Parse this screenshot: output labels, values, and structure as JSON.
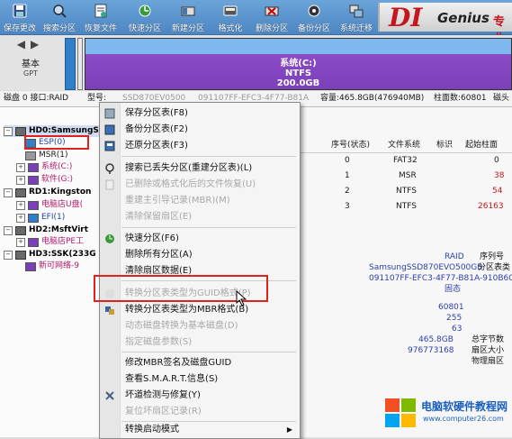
{
  "toolbar": {
    "buttons": [
      {
        "label": "保存更改",
        "icon": "save-icon"
      },
      {
        "label": "搜索分区",
        "icon": "search-partition-icon"
      },
      {
        "label": "恢复文件",
        "icon": "recover-file-icon"
      },
      {
        "label": "快速分区",
        "icon": "quick-partition-icon"
      },
      {
        "label": "新建分区",
        "icon": "new-partition-icon"
      },
      {
        "label": "格式化",
        "icon": "format-icon"
      },
      {
        "label": "删除分区",
        "icon": "delete-partition-icon"
      },
      {
        "label": "备份分区",
        "icon": "backup-partition-icon"
      },
      {
        "label": "系统迁移",
        "icon": "system-migrate-icon"
      }
    ],
    "logo": {
      "d": "DI",
      "genius": "Genius",
      "tail": "专业"
    }
  },
  "diskbar": {
    "nav_label": "基本",
    "nav_sub": "GPT",
    "partition_name": "系统(C:)",
    "partition_fs": "NTFS",
    "partition_size": "200.0GB"
  },
  "infoline": {
    "disk": "磁盘 0 接口:RAID",
    "model": "型号:",
    "model_val": "SSD870EV0500",
    "serial": "091107FF-EFC3-4F77-B81A",
    "capacity": "容量:465.8GB(476940MB)",
    "cylinders": "柱面数:60801",
    "tail": "磁头"
  },
  "tree": {
    "hd0": "HD0:SamsungS",
    "hd0_parts": [
      "ESP(0)",
      "MSR(1)",
      "系统(C:)",
      "软件(G:)"
    ],
    "rd1": "RD1:Kingston",
    "rd1_parts": [
      "电脑店U盘(",
      "EFI(1)"
    ],
    "hd2": "HD2:MsftVirt",
    "hd2_parts": [
      "电脑店PE工"
    ],
    "hd3": "HD3:SSK(233G",
    "hd3_parts": [
      "新可网络-9"
    ]
  },
  "table": {
    "headers": [
      "序号(状态)",
      "文件系统",
      "标识",
      "起始柱面"
    ],
    "rows": [
      {
        "idx": "0",
        "fs": "FAT32",
        "id": "",
        "start": "0"
      },
      {
        "idx": "1",
        "fs": "MSR",
        "id": "",
        "start": "38"
      },
      {
        "idx": "2",
        "fs": "NTFS",
        "id": "",
        "start": "54"
      },
      {
        "idx": "3",
        "fs": "NTFS",
        "id": "",
        "start": "26163"
      }
    ]
  },
  "details": {
    "raid": "RAID",
    "model": "SamsungSSD870EVO500GB",
    "guid": "091107FF-EFC3-4F77-B81A-910B60DA",
    "solid": "固态",
    "serial_label": "序列号",
    "ptable_label": "分区表类",
    "v1": "60801",
    "v2": "255",
    "v3": "63",
    "v4": "465.8GB",
    "v5": "976773168",
    "total_label": "总字节数",
    "sector_label": "扇区大小",
    "phys_label": "物理扇区"
  },
  "menu": {
    "items": [
      {
        "label": "保存分区表(F8)",
        "disabled": false,
        "icon": "save-table-icon"
      },
      {
        "label": "备份分区表(F2)",
        "disabled": false,
        "icon": "backup-table-icon"
      },
      {
        "label": "还原分区表(F3)",
        "disabled": false,
        "icon": "restore-table-icon"
      },
      {
        "label": "搜索已丢失分区(重建分区表)(L)",
        "disabled": false,
        "icon": "search-lost-icon"
      },
      {
        "label": "已删除或格式化后的文件恢复(U)",
        "disabled": true,
        "icon": "file-recover-icon"
      },
      {
        "label": "重建主引导记录(MBR)(M)",
        "disabled": true,
        "icon": ""
      },
      {
        "label": "清除保留扇区(E)",
        "disabled": true,
        "icon": ""
      },
      {
        "label": "快速分区(F6)",
        "disabled": false,
        "icon": "quick-partition-menu-icon"
      },
      {
        "label": "删除所有分区(A)",
        "disabled": false,
        "icon": ""
      },
      {
        "label": "清除扇区数据(E)",
        "disabled": false,
        "icon": ""
      },
      {
        "label": "转换分区表类型为GUID格式(P)",
        "disabled": true,
        "icon": "convert-guid-icon"
      },
      {
        "label": "转换分区表类型为MBR格式(B)",
        "disabled": false,
        "icon": "convert-mbr-icon"
      },
      {
        "label": "动态磁盘转换为基本磁盘(D)",
        "disabled": true,
        "icon": ""
      },
      {
        "label": "指定磁盘参数(S)",
        "disabled": true,
        "icon": ""
      },
      {
        "label": "修改MBR签名及磁盘GUID",
        "disabled": false,
        "icon": ""
      },
      {
        "label": "查看S.M.A.R.T.信息(S)",
        "disabled": false,
        "icon": ""
      },
      {
        "label": "坏道检测与修复(Y)",
        "disabled": false,
        "icon": "bad-sector-icon"
      },
      {
        "label": "复位坏扇区记录(R)",
        "disabled": true,
        "icon": ""
      },
      {
        "label": "转换启动模式",
        "disabled": false,
        "icon": ""
      }
    ]
  },
  "watermark": {
    "title": "电脑软硬件教程网",
    "url": "www.computer26.com"
  }
}
